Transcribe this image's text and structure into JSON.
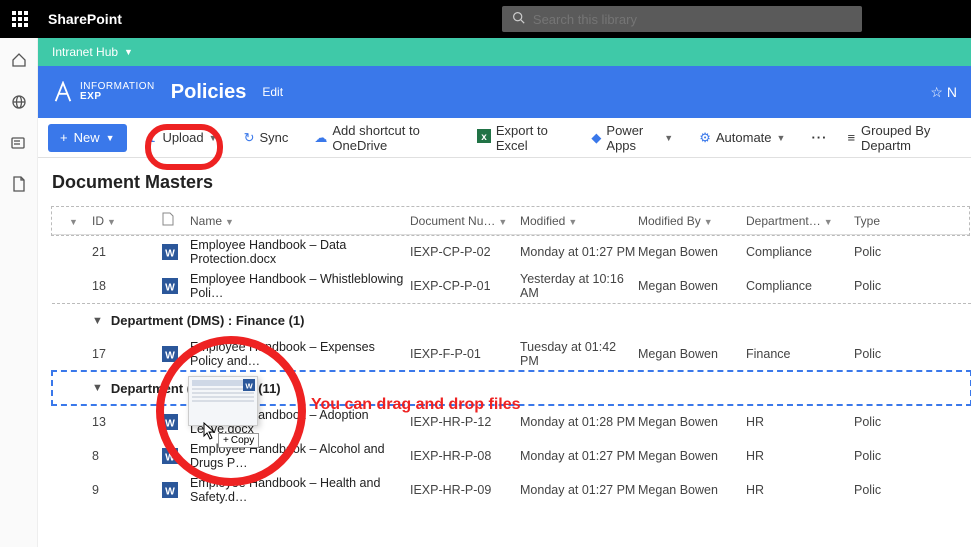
{
  "topbar": {
    "app": "SharePoint",
    "search_placeholder": "Search this library"
  },
  "hub": {
    "label": "Intranet Hub"
  },
  "site": {
    "logo_top": "INFORMATION",
    "logo_bottom": "EXP",
    "title": "Policies",
    "edit": "Edit",
    "follow": "N"
  },
  "cmd": {
    "new": "New",
    "upload": "Upload",
    "sync": "Sync",
    "shortcut": "Add shortcut to OneDrive",
    "export": "Export to Excel",
    "powerapps": "Power Apps",
    "automate": "Automate",
    "groupby": "Grouped By Departm"
  },
  "library": {
    "title": "Document Masters"
  },
  "columns": {
    "id": "ID",
    "name": "Name",
    "docnum": "Document Nu…",
    "modified": "Modified",
    "modifiedby": "Modified By",
    "department": "Department…",
    "type": "Type"
  },
  "groups": {
    "g1_hidden_rows": [
      {
        "id": "21",
        "name": "Employee Handbook – Data Protection.docx",
        "dnum": "IEXP-CP-P-02",
        "mod": "Monday at 01:27 PM",
        "by": "Megan Bowen",
        "dept": "Compliance",
        "type": "Polic"
      },
      {
        "id": "18",
        "name": "Employee Handbook – Whistleblowing Poli…",
        "dnum": "IEXP-CP-P-01",
        "mod": "Yesterday at 10:16 AM",
        "by": "Megan Bowen",
        "dept": "Compliance",
        "type": "Polic"
      }
    ],
    "finance": {
      "label": "Department (DMS) : Finance (1)",
      "rows": [
        {
          "id": "17",
          "name": "Employee Handbook – Expenses Policy and…",
          "dnum": "IEXP-F-P-01",
          "mod": "Tuesday at 01:42 PM",
          "by": "Megan Bowen",
          "dept": "Finance",
          "type": "Polic"
        }
      ]
    },
    "hr": {
      "label": "Department (DMS) : HR (11)",
      "rows": [
        {
          "id": "13",
          "name": "Employee Handbook – Adoption Leave.docx",
          "dnum": "IEXP-HR-P-12",
          "mod": "Monday at 01:28 PM",
          "by": "Megan Bowen",
          "dept": "HR",
          "type": "Polic"
        },
        {
          "id": "8",
          "name": "Employee Handbook – Alcohol and Drugs P…",
          "dnum": "IEXP-HR-P-08",
          "mod": "Monday at 01:27 PM",
          "by": "Megan Bowen",
          "dept": "HR",
          "type": "Polic"
        },
        {
          "id": "9",
          "name": "Employee Handbook – Health and Safety.d…",
          "dnum": "IEXP-HR-P-09",
          "mod": "Monday at 01:27 PM",
          "by": "Megan Bowen",
          "dept": "HR",
          "type": "Polic"
        }
      ]
    }
  },
  "drag": {
    "badge": "Copy"
  },
  "annotation": {
    "text": "You can drag and drop files"
  },
  "leftrail": {
    "i1": "home-icon",
    "i2": "globe-icon",
    "i3": "news-icon",
    "i4": "files-icon"
  }
}
